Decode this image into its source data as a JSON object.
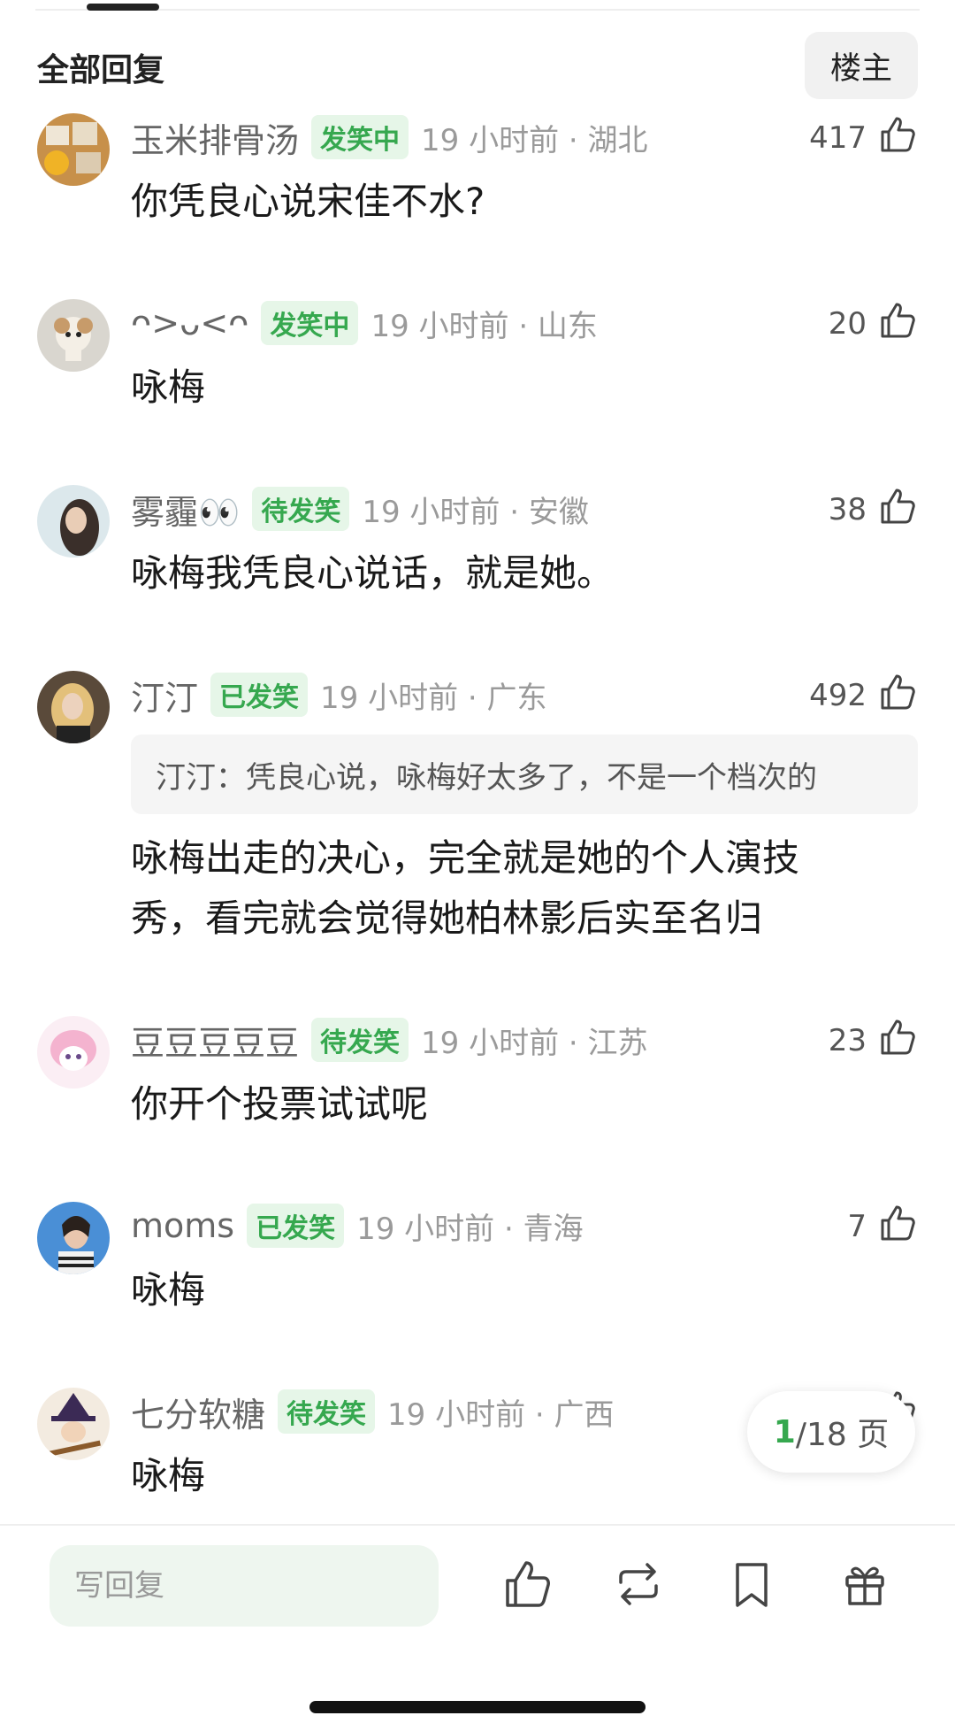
{
  "header": {
    "title": "全部回复",
    "owner_button": "楼主"
  },
  "comments": [
    {
      "username": "玉米排骨汤",
      "badge": "发笑中",
      "meta": "19 小时前 · 湖北",
      "likes": "417",
      "text": "你凭良心说宋佳不水?"
    },
    {
      "username": "ᴖ>ᴗ<ᴖ",
      "badge": "发笑中",
      "meta": "19 小时前 · 山东",
      "likes": "20",
      "text": "咏梅"
    },
    {
      "username": "雾霾👀",
      "badge": "待发笑",
      "meta": "19 小时前 · 安徽",
      "likes": "38",
      "text": "咏梅我凭良心说话，就是她。"
    },
    {
      "username": "汀汀",
      "badge": "已发笑",
      "meta": "19 小时前 · 广东",
      "likes": "492",
      "quote": "汀汀：凭良心说，咏梅好太多了，不是一个档次的",
      "text_line1": "咏梅出走的决心，完全就是她的个人演技",
      "text_line2": "秀，看完就会觉得她柏林影后实至名归"
    },
    {
      "username": "豆豆豆豆豆",
      "badge": "待发笑",
      "meta": "19 小时前 · 江苏",
      "likes": "23",
      "text": "你开个投票试试呢"
    },
    {
      "username": "moms",
      "badge": "已发笑",
      "meta": "19 小时前 · 青海",
      "likes": "7",
      "text": "咏梅"
    },
    {
      "username": "七分软糖",
      "badge": "待发笑",
      "meta": "19 小时前 · 广西",
      "likes": "",
      "text": "咏梅"
    }
  ],
  "pagination": {
    "current": "1",
    "total": "/18 页"
  },
  "bottom_bar": {
    "reply_placeholder": "写回复"
  },
  "colors": {
    "accent_green": "#36a84f",
    "badge_bg": "#e6f6e8"
  }
}
